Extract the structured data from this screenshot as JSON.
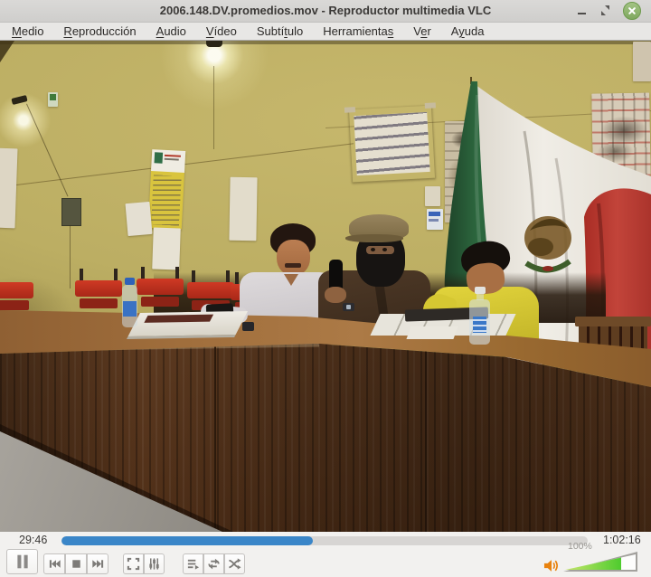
{
  "window": {
    "title": "2006.148.DV.promedios.mov - Reproductor multimedia VLC",
    "controls": [
      {
        "id": "minimize",
        "icon": "minimize-icon"
      },
      {
        "id": "restore",
        "icon": "restore-icon"
      },
      {
        "id": "close",
        "icon": "close-icon"
      }
    ]
  },
  "menu": {
    "items": [
      {
        "id": "medio",
        "label": "Medio",
        "u": 0
      },
      {
        "id": "reproduccion",
        "label": "Reproducción",
        "u": 0
      },
      {
        "id": "audio",
        "label": "Audio",
        "u": 0
      },
      {
        "id": "video",
        "label": "Vídeo",
        "u": 0
      },
      {
        "id": "subtitulo",
        "label": "Subtítulo",
        "u": 5
      },
      {
        "id": "herramientas",
        "label": "Herramientas",
        "u": 11
      },
      {
        "id": "ver",
        "label": "Ver",
        "u": 1
      },
      {
        "id": "ayuda",
        "label": "Ayuda",
        "u": 1
      }
    ]
  },
  "player": {
    "elapsed": "29:46",
    "duration": "1:02:16",
    "progress_pct": 47.8,
    "progress_style": "width:47.8%",
    "volume_label": "100%",
    "volume_pct": 100,
    "volume_fill_style": "width:80%",
    "toolbar_icons": [
      "pause-icon",
      "previous-icon",
      "stop-icon",
      "next-icon",
      "fullscreen-icon",
      "equalizer-icon",
      "playlist-icon",
      "loop-icon",
      "shuffle-icon",
      "speaker-icon"
    ]
  },
  "colors": {
    "accent_blue": "#3a86c8",
    "volume_green": "#4ecb2e",
    "speaker_orange": "#e8820e",
    "close_button_green": "#8fb869",
    "flag_green": "#2a5c38",
    "flag_red": "#b5342c",
    "wall_khaki": "#b9ab60",
    "table_wood": "#54301b"
  },
  "scene": {
    "description": "Assembly-hall video frame: three men seated behind a long wooden table (one in black balaclava with cap), Mexican flag draped on khaki wall, handwritten posters, red stacking chairs, water bottles and papers on table"
  }
}
